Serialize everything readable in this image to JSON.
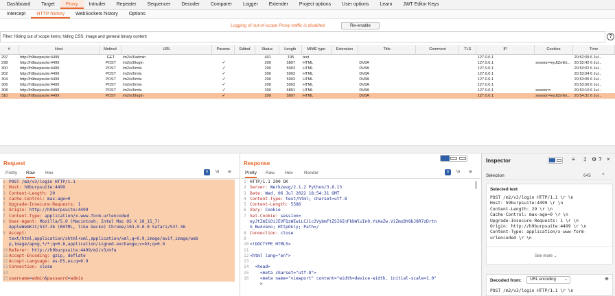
{
  "nav": {
    "main_tabs": [
      "Dashboard",
      "Target",
      "Proxy",
      "Intruder",
      "Repeater",
      "Sequencer",
      "Decoder",
      "Comparer",
      "Logger",
      "Extender",
      "Project options",
      "User options",
      "Learn",
      "JWT Editor Keys"
    ],
    "proxy_tabs": [
      "Intercept",
      "HTTP history",
      "WebSockets history",
      "Options"
    ]
  },
  "notice": {
    "message": "Logging of out-of-scope Proxy traffic is disabled",
    "button": "Re-enable"
  },
  "filter": {
    "text": "Filter: Hiding out of scope items;  hiding CSS, image and general binary content",
    "help": "?"
  },
  "table": {
    "headers": [
      "#",
      "Host",
      "Method",
      "URL",
      "Params",
      "Edited",
      "Status",
      "Length",
      "MIME type",
      "Extension",
      "Title",
      "Comment",
      "TLS",
      "IP",
      "Cookies",
      "Time"
    ],
    "rows": [
      {
        "id": "297",
        "host": "http://h9burpsuite:4499",
        "method": "GET",
        "url": "/m2/v3/admin",
        "params": "",
        "edited": "",
        "status": "401",
        "length": "195",
        "mime": "text",
        "ext": "",
        "title": "",
        "comment": "",
        "tls": "",
        "ip": "127.0.0.1",
        "cookies": "",
        "time": "20:52:09 6 Jul..."
      },
      {
        "id": "298",
        "host": "http://h9burpsuite:4499",
        "method": "POST",
        "url": "/m2/v3/login",
        "params": "✓",
        "edited": "",
        "status": "200",
        "length": "5897",
        "mime": "HTML",
        "ext": "",
        "title": "DV8A",
        "comment": "",
        "tls": "",
        "ip": "127.0.0.1",
        "cookies": "session=eyJtZmEi...",
        "time": "20:52:42 6 Jul..."
      },
      {
        "id": "300",
        "host": "http://h9burpsuite:4499",
        "method": "POST",
        "url": "/m2/v3/mfa",
        "params": "✓",
        "edited": "",
        "status": "200",
        "length": "5903",
        "mime": "HTML",
        "ext": "",
        "title": "DV8A",
        "comment": "",
        "tls": "",
        "ip": "127.0.0.1",
        "cookies": "",
        "time": "20:53:02 6 Jul..."
      },
      {
        "id": "302",
        "host": "http://h9burpsuite:4499",
        "method": "POST",
        "url": "/m2/v3/mfa",
        "params": "✓",
        "edited": "",
        "status": "200",
        "length": "5903",
        "mime": "HTML",
        "ext": "",
        "title": "DV8A",
        "comment": "",
        "tls": "",
        "ip": "127.0.0.1",
        "cookies": "",
        "time": "20:53:04 6 Jul..."
      },
      {
        "id": "304",
        "host": "http://h9burpsuite:4499",
        "method": "POST",
        "url": "/m2/v3/mfa",
        "params": "✓",
        "edited": "",
        "status": "200",
        "length": "5903",
        "mime": "HTML",
        "ext": "",
        "title": "DV8A",
        "comment": "",
        "tls": "",
        "ip": "127.0.0.1",
        "cookies": "",
        "time": "20:53:05 6 Jul..."
      },
      {
        "id": "306",
        "host": "http://h9burpsuite:4499",
        "method": "POST",
        "url": "/m2/v3/mfa",
        "params": "✓",
        "edited": "",
        "status": "200",
        "length": "5903",
        "mime": "HTML",
        "ext": "",
        "title": "DV8A",
        "comment": "",
        "tls": "",
        "ip": "127.0.0.1",
        "cookies": "",
        "time": "20:53:06 6 Jul..."
      },
      {
        "id": "308",
        "host": "http://h9burpsuite:4499",
        "method": "POST",
        "url": "/m2/v3/mfa",
        "params": "✓",
        "edited": "",
        "status": "200",
        "length": "6891",
        "mime": "HTML",
        "ext": "",
        "title": "DV8A",
        "comment": "",
        "tls": "",
        "ip": "127.0.0.1",
        "cookies": "session=",
        "time": "20:53:10 6 Jul..."
      },
      {
        "id": "310",
        "host": "http://h9burpsuite:4499",
        "method": "POST",
        "url": "/m2/v3/login",
        "params": "✓",
        "edited": "",
        "status": "200",
        "length": "5897",
        "mime": "HTML",
        "ext": "",
        "title": "DV8A",
        "comment": "",
        "tls": "",
        "ip": "127.0.0.1",
        "cookies": "session=eyJtZmEi...",
        "time": "20:54:31 6 Jul..."
      }
    ],
    "selected_row": 7
  },
  "request": {
    "title": "Request",
    "tabs": [
      "Pretty",
      "Raw",
      "Hex"
    ],
    "active_tab": "Raw",
    "lines": [
      {
        "n": "1",
        "text": "POST /m2/v3/login HTTP/1.1"
      },
      {
        "n": "2",
        "text": "Host: h9burpsuite:4499"
      },
      {
        "n": "3",
        "text": "Content-Length: 29"
      },
      {
        "n": "4",
        "text": "Cache-Control: max-age=0"
      },
      {
        "n": "5",
        "text": "Upgrade-Insecure-Requests: 1"
      },
      {
        "n": "6",
        "text": "Origin: http://h9burpsuite:4499"
      },
      {
        "n": "7",
        "text": "Content-Type: application/x-www-form-urlencoded"
      },
      {
        "n": "8",
        "text": "User-Agent: Mozilla/5.0 (Macintosh; Intel Mac OS X 10_15_7)"
      },
      {
        "n": "",
        "text": "AppleWebKit/537.36 (KHTML, like Gecko) Chrome/103.0.0.0 Safari/537.36"
      },
      {
        "n": "9",
        "text": "Accept:"
      },
      {
        "n": "",
        "text": "text/html,application/xhtml+xml,application/xml;q=0.9,image/avif,image/web"
      },
      {
        "n": "",
        "text": "p,image/apng,*/*;q=0.8,application/signed-exchange;v=b3;q=0.9"
      },
      {
        "n": "10",
        "text": "Referer: http://h9burpsuite:4499/m2/v3/mfa"
      },
      {
        "n": "11",
        "text": "Accept-Encoding: gzip, deflate"
      },
      {
        "n": "12",
        "text": "Accept-Language: es-ES,es;q=0.9"
      },
      {
        "n": "13",
        "text": "Connection: close"
      },
      {
        "n": "14",
        "text": ""
      },
      {
        "n": "15",
        "text": "username=admin&password=admin"
      }
    ]
  },
  "response": {
    "title": "Response",
    "tabs": [
      "Pretty",
      "Raw",
      "Hex",
      "Render"
    ],
    "active_tab": "Pretty",
    "lines": [
      {
        "n": "1",
        "text": "HTTP/1.1 200 OK"
      },
      {
        "n": "2",
        "text": "Server: Werkzeug/2.1.2 Python/3.8.13"
      },
      {
        "n": "3",
        "text": "Date: Wed, 06 Jul 2022 18:54:31 GMT"
      },
      {
        "n": "4",
        "text": "Content-Type: text/html; charset=utf-8"
      },
      {
        "n": "5",
        "text": "Content-Length: 5586"
      },
      {
        "n": "6",
        "text": "Vary: Cookie"
      },
      {
        "n": "7",
        "text": "Set-Cookie: session="
      },
      {
        "n": "",
        "text": "eyJtZmEiOiJEVFQzWEwiLCJ1c2VybmFtZSI6InFkbWluIn0.YsXaZw.ViZmxBY6bJ8R7zDrtn"
      },
      {
        "n": "",
        "text": "G_Bw4veno; HttpOnly; Path=/"
      },
      {
        "n": "8",
        "text": "Connection: close"
      },
      {
        "n": "9",
        "text": ""
      },
      {
        "n": "10",
        "text": "<!DOCTYPE HTML5>"
      },
      {
        "n": "11",
        "text": ""
      },
      {
        "n": "12",
        "text": "<html lang=\"en\">"
      },
      {
        "n": "13",
        "text": ""
      },
      {
        "n": "14",
        "text": "  <head>"
      },
      {
        "n": "15",
        "text": "    <meta charset=\"utf-8\">"
      },
      {
        "n": "16",
        "text": "    <meta name=\"viewport\" content=\"width=device-width, initial-scale=1.0\""
      },
      {
        "n": "",
        "text": "    >"
      }
    ]
  },
  "inspector": {
    "title": "Inspector",
    "selection_label": "Selection",
    "selection_count": "645",
    "selected_text_label": "Selected text",
    "selected_text": [
      "POST /m2/v3/login HTTP/1.1 \\r \\n",
      "Host: h9burpsuite:4499 \\r \\n",
      "Content-Length: 29 \\r \\n",
      "Cache-Control: max-age=0 \\r \\n",
      "Upgrade-Insecure-Requests: 1 \\r \\n",
      "Origin: http://h9burpsuite:4499 \\r \\n",
      "Content-Type: application/x-www-form-",
      "urlencoded \\r \\n"
    ],
    "see_more": "See more",
    "decoded_from_label": "Decoded from:",
    "decoded_from_value": "URL encoding",
    "decoded_text": "POST /m2/v3/login HTTP/1.1 \\r \\n"
  },
  "colors": {
    "accent": "#e8682a",
    "selected_row": "#f8c19b",
    "highlight": "#f9cfae",
    "button_blue": "#2f5fa8"
  }
}
